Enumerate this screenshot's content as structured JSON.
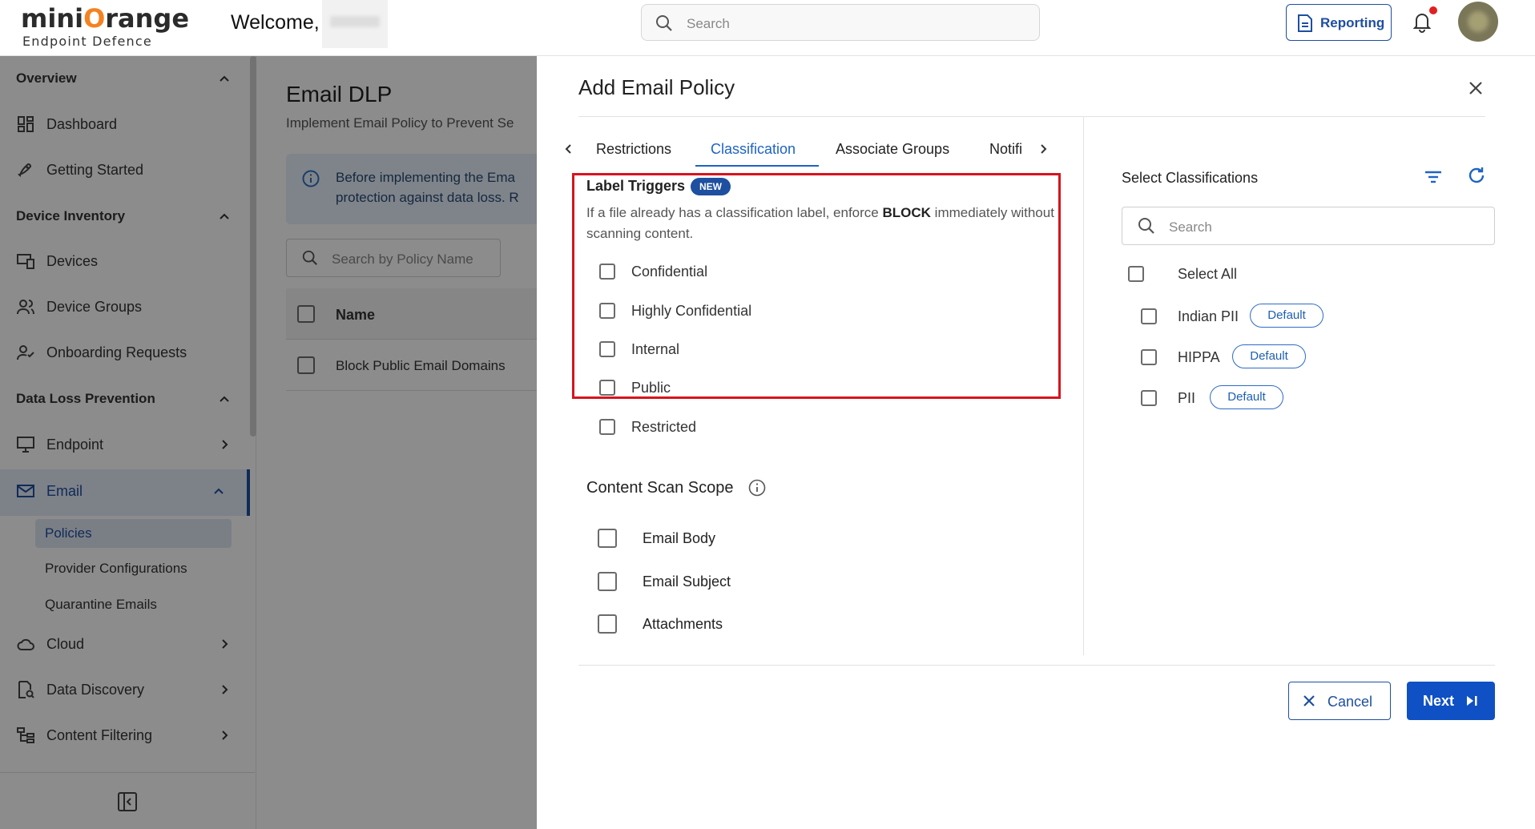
{
  "header": {
    "logo_main_a": "mini",
    "logo_main_o": "O",
    "logo_main_b": "range",
    "logo_sub": "Endpoint Defence",
    "welcome": "Welcome,",
    "search_placeholder": "Search",
    "reporting_label": "Reporting"
  },
  "sidebar": {
    "overview": "Overview",
    "dashboard": "Dashboard",
    "getting_started": "Getting Started",
    "device_inventory": "Device Inventory",
    "devices": "Devices",
    "device_groups": "Device Groups",
    "onboarding_requests": "Onboarding Requests",
    "data_loss_prevention": "Data Loss Prevention",
    "endpoint": "Endpoint",
    "email": "Email",
    "policies": "Policies",
    "provider_configurations": "Provider Configurations",
    "quarantine_emails": "Quarantine Emails",
    "cloud": "Cloud",
    "data_discovery": "Data Discovery",
    "content_filtering": "Content Filtering"
  },
  "main": {
    "title": "Email DLP",
    "subtitle": "Implement Email Policy to Prevent Se",
    "info_line1": "Before implementing the Ema",
    "info_line2": "protection against data loss. R",
    "search_placeholder": "Search by Policy Name",
    "table_header_name": "Name",
    "rows": [
      "Block Public Email Domains"
    ]
  },
  "dialog": {
    "title": "Add Email Policy",
    "tabs": [
      "Restrictions",
      "Classification",
      "Associate Groups",
      "Notifi"
    ],
    "label_triggers": {
      "title": "Label Triggers",
      "badge": "NEW",
      "desc_pre": "If a file already has a classification label, enforce ",
      "desc_bold": "BLOCK",
      "desc_post": " immediately without scanning content.",
      "options": [
        "Confidential",
        "Highly Confidential",
        "Internal",
        "Public",
        "Restricted"
      ]
    },
    "content_scan": {
      "title": "Content Scan Scope",
      "options": [
        "Email Body",
        "Email Subject",
        "Attachments"
      ]
    },
    "classifications": {
      "title": "Select Classifications",
      "search_placeholder": "Search",
      "select_all": "Select All",
      "items": [
        {
          "label": "Indian PII",
          "badge": "Default"
        },
        {
          "label": "HIPPA",
          "badge": "Default"
        },
        {
          "label": "PII",
          "badge": "Default"
        }
      ]
    },
    "cancel_label": "Cancel",
    "next_label": "Next"
  }
}
